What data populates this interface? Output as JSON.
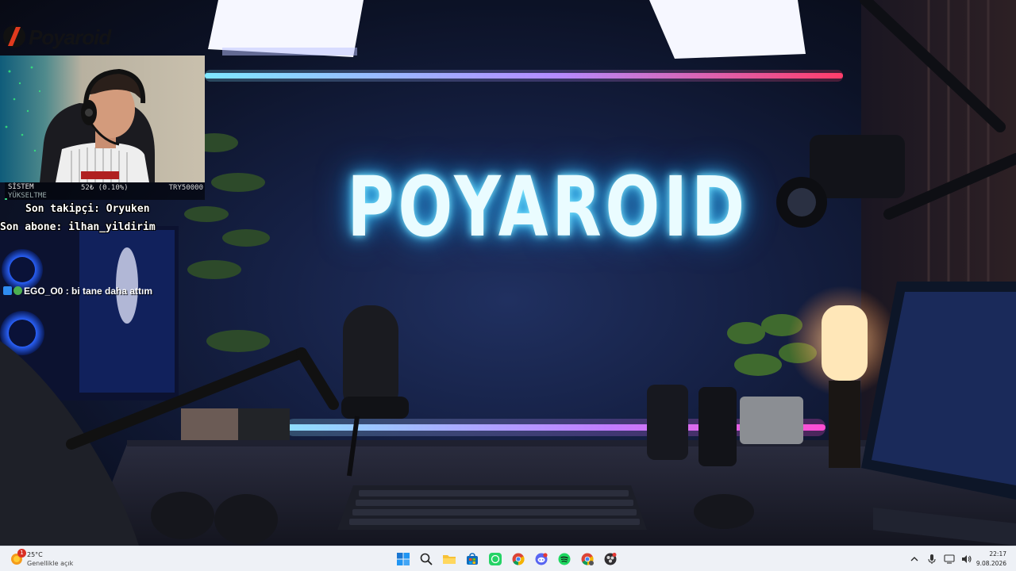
{
  "scene": {
    "title": "POYAROID"
  },
  "overlay": {
    "logo_text": "Poyaroid",
    "stats": {
      "label_line1": "SİSTEM",
      "label_line2": "YÜKSELTME",
      "count": "52₺ (0.10%)",
      "goal": "TRY50000",
      "progress_fraction": 0.001
    },
    "last_follower": "Son takipçi: Oryuken",
    "last_subscriber": "Son abone: ilhan_yildirim",
    "chat": {
      "user": "EGO_O0",
      "separator": " : ",
      "message": "bi tane daha attım"
    }
  },
  "taskbar": {
    "weather": {
      "badge": "1",
      "temperature": "25°C",
      "description": "Genellikle açık"
    },
    "apps": [
      {
        "name": "start-button",
        "icon": "windows-icon"
      },
      {
        "name": "search-button",
        "icon": "search-icon"
      },
      {
        "name": "file-explorer-button",
        "icon": "folder-icon"
      },
      {
        "name": "store-button",
        "icon": "store-icon"
      },
      {
        "name": "whatsapp-button",
        "icon": "whatsapp-icon"
      },
      {
        "name": "chrome-button",
        "icon": "chrome-icon"
      },
      {
        "name": "discord-button",
        "icon": "discord-icon"
      },
      {
        "name": "spotify-button",
        "icon": "spotify-icon"
      },
      {
        "name": "chrome-profile-button",
        "icon": "chrome-icon"
      },
      {
        "name": "obs-button",
        "icon": "obs-icon"
      }
    ],
    "clock": {
      "time": "22:17",
      "date": "9.08.2026"
    }
  },
  "colors": {
    "neon_cyan": "#7fe8ff",
    "neon_pink": "#ff3d8b",
    "taskbar_bg": "#eef1f6"
  }
}
